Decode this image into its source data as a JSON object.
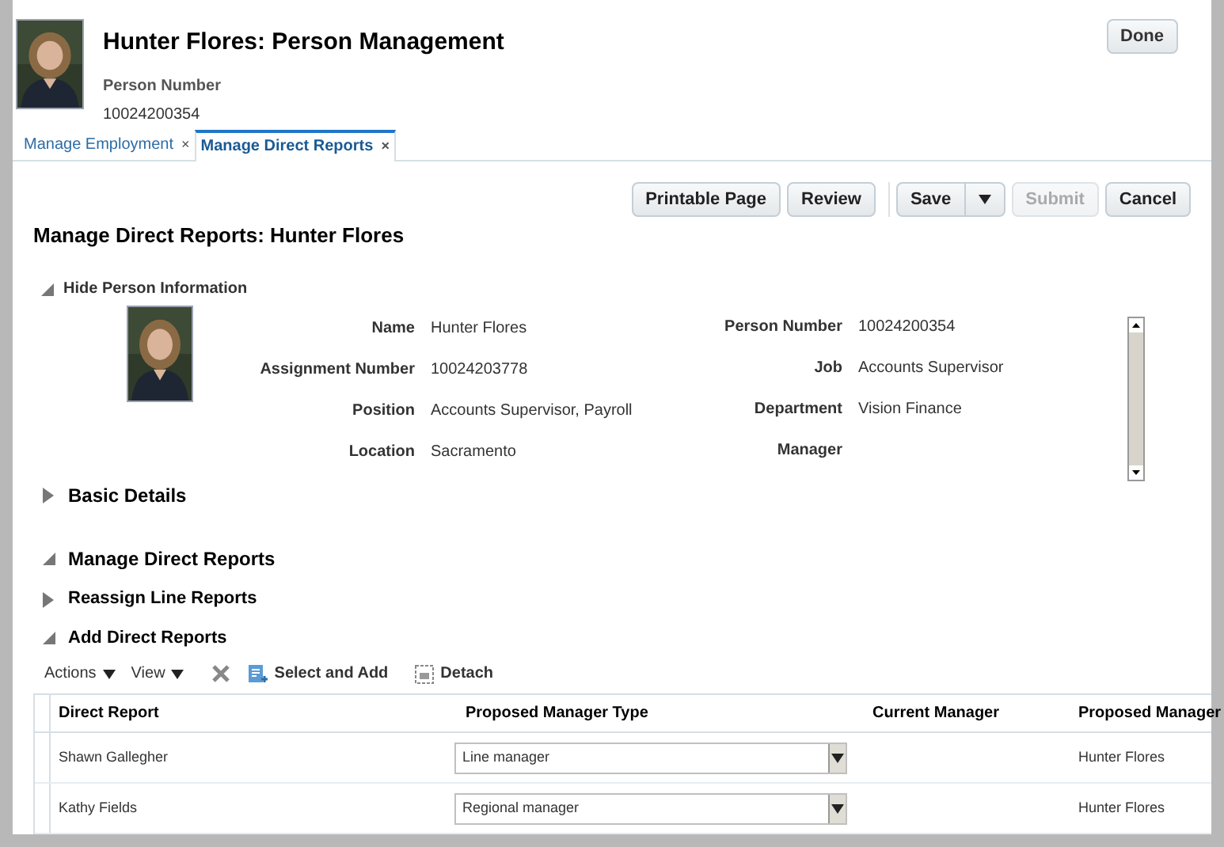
{
  "header": {
    "title": "Hunter Flores: Person Management",
    "person_number_label": "Person Number",
    "person_number": "10024200354",
    "done": "Done"
  },
  "tabs": [
    {
      "label": "Manage Employment",
      "close": "×",
      "selected": false
    },
    {
      "label": "Manage Direct Reports",
      "close": "×",
      "selected": true
    }
  ],
  "toolbar": [
    {
      "label": "Printable Page",
      "kind": "button",
      "disabled": false
    },
    {
      "label": "Review",
      "kind": "button",
      "disabled": false
    },
    {
      "label": "Save",
      "kind": "split",
      "disabled": false
    },
    {
      "label": "Submit",
      "kind": "button",
      "disabled": true
    },
    {
      "label": "Cancel",
      "kind": "button",
      "disabled": false
    }
  ],
  "page_title": "Manage Direct Reports: Hunter Flores",
  "person_info": {
    "toggle": "Hide Person Information",
    "expanded": true,
    "left": [
      {
        "label": "Name",
        "value": "Hunter Flores"
      },
      {
        "label": "Assignment Number",
        "value": "10024203778"
      },
      {
        "label": "Position",
        "value": "Accounts Supervisor, Payroll"
      },
      {
        "label": "Location",
        "value": "Sacramento"
      }
    ],
    "right": [
      {
        "label": "Person Number",
        "value": "10024200354"
      },
      {
        "label": "Job",
        "value": "Accounts Supervisor"
      },
      {
        "label": "Department",
        "value": "Vision Finance"
      },
      {
        "label": "Manager"
      }
    ]
  },
  "sections": [
    {
      "title": "Basic Details",
      "expanded": false
    },
    {
      "title": "Manage Direct Reports",
      "expanded": true
    },
    {
      "title": "Reassign Line Reports",
      "expanded": false
    },
    {
      "title": "Add Direct Reports",
      "expanded": true
    }
  ],
  "table_toolbar": {
    "actions": "Actions",
    "view": "View",
    "select_and_add": "Select and Add",
    "detach": "Detach"
  },
  "table": {
    "columns": [
      "Direct Report",
      "Proposed Manager Type",
      "Current Manager",
      "Proposed Manager"
    ],
    "rows": [
      {
        "direct_report": "Shawn Gallegher",
        "proposed_manager_type": "Line manager",
        "proposed_manager": "Hunter Flores"
      },
      {
        "direct_report": "Kathy Fields",
        "proposed_manager_type": "Regional manager",
        "proposed_manager": "Hunter Flores"
      }
    ]
  }
}
